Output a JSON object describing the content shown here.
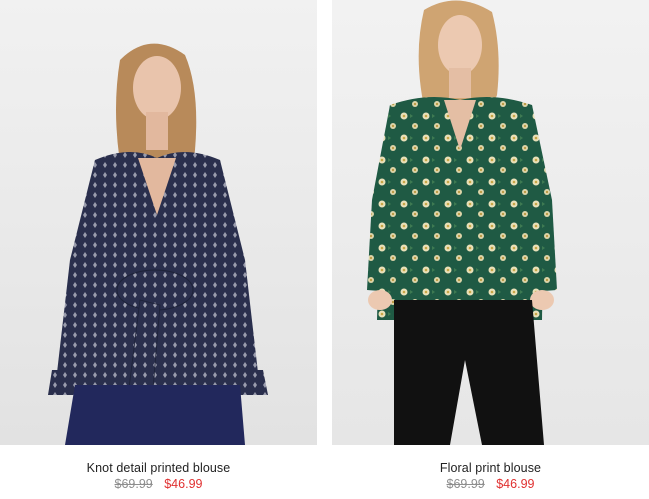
{
  "products": [
    {
      "name": "Knot detail printed blouse",
      "original_price": "$69.99",
      "sale_price": "$46.99",
      "image": "model-in-navy-printed-knot-blouse"
    },
    {
      "name": "Floral print blouse",
      "original_price": "$69.99",
      "sale_price": "$46.99",
      "image": "model-in-green-floral-blouse"
    }
  ],
  "colors": {
    "sale_price": "#e03030",
    "original_price": "#8e8e8e",
    "product_name": "#222222",
    "photo_background": "#ebebeb"
  }
}
